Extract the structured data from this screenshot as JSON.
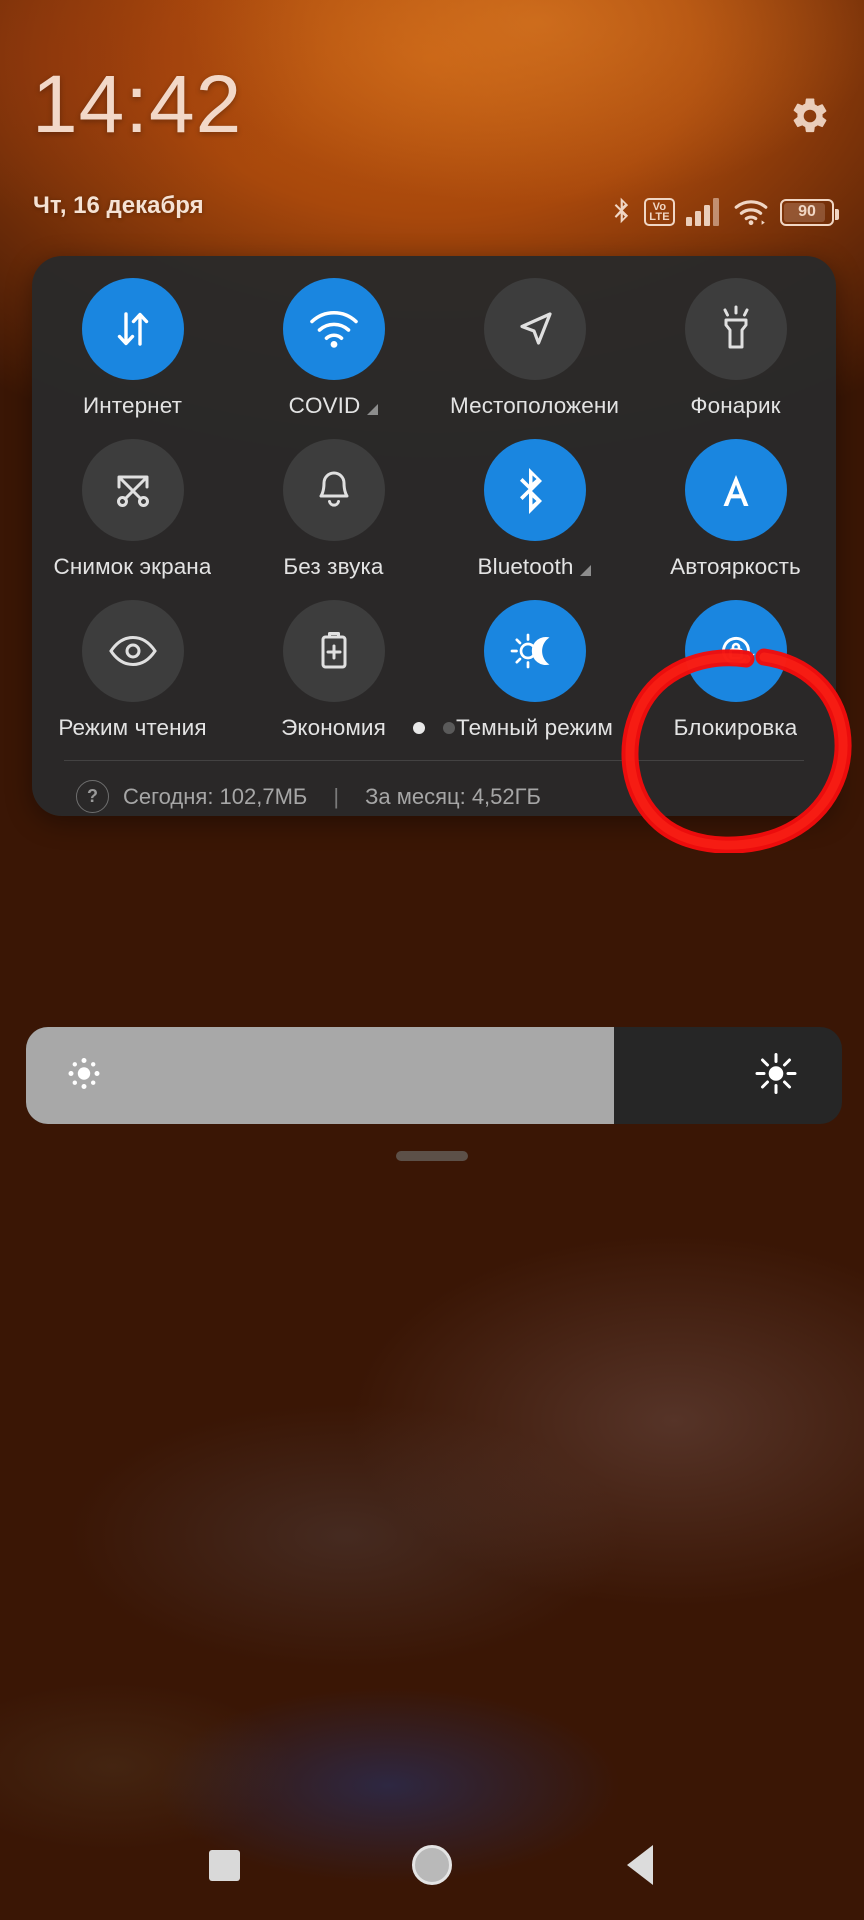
{
  "statusbar": {
    "time": "14:42",
    "date": "Чт, 16 декабря",
    "settings_icon": "gear-icon",
    "icons": [
      {
        "name": "bluetooth-icon",
        "label": "Bluetooth"
      },
      {
        "name": "volte-icon",
        "label_top": "Vo",
        "label_bottom": "LTE"
      },
      {
        "name": "cellular-signal-icon",
        "label": "Signal"
      },
      {
        "name": "wifi-icon",
        "label": "Wi-Fi"
      },
      {
        "name": "battery-icon",
        "level": "90"
      }
    ],
    "battery_level": "90"
  },
  "quick_settings": {
    "tiles": [
      {
        "label": "Интернет",
        "icon": "data-transfer-icon",
        "active": true,
        "expandable": false,
        "clip": false
      },
      {
        "label": "COVID",
        "icon": "wifi-icon",
        "active": true,
        "expandable": true,
        "clip": false
      },
      {
        "label": "Местоположени",
        "icon": "location-arrow-icon",
        "active": false,
        "expandable": false,
        "clip": true
      },
      {
        "label": "Фонарик",
        "icon": "flashlight-icon",
        "active": false,
        "expandable": false,
        "clip": false
      },
      {
        "label": "Снимок экрана",
        "icon": "screenshot-icon",
        "active": false,
        "expandable": false,
        "clip": false
      },
      {
        "label": "Без звука",
        "icon": "bell-icon",
        "active": false,
        "expandable": false,
        "clip": false
      },
      {
        "label": "Bluetooth",
        "icon": "bluetooth-icon",
        "active": true,
        "expandable": true,
        "clip": false
      },
      {
        "label": "Автояркость",
        "icon": "auto-brightness-icon",
        "active": true,
        "expandable": false,
        "clip": false
      },
      {
        "label": "Режим чтения",
        "icon": "eye-icon",
        "active": false,
        "expandable": false,
        "clip": false
      },
      {
        "label": "Экономия",
        "icon": "battery-saver-icon",
        "active": false,
        "expandable": false,
        "clip": false
      },
      {
        "label": "Темный режим",
        "icon": "dark-mode-icon",
        "active": true,
        "expandable": false,
        "clip": false
      },
      {
        "label": "Блокировка",
        "icon": "rotation-lock-icon",
        "active": true,
        "expandable": false,
        "clip": false
      }
    ],
    "pages": {
      "count": 2,
      "current": 1
    },
    "data_usage": {
      "help_icon_label": "?",
      "today": "Сегодня: 102,7МБ",
      "separator": "|",
      "month": "За месяц: 4,52ГБ"
    }
  },
  "brightness": {
    "value_percent": 72,
    "low_icon": "brightness-low-icon",
    "high_icon": "brightness-high-icon"
  },
  "annotation": {
    "color": "#f20c0c",
    "target": "Блокировка",
    "shape": "hand-drawn-circle"
  },
  "navbar": {
    "buttons": [
      {
        "name": "recents-button",
        "glyph": "square"
      },
      {
        "name": "home-button",
        "glyph": "circle"
      },
      {
        "name": "back-button",
        "glyph": "triangle"
      }
    ]
  },
  "theme": {
    "accent": "#1a86e0",
    "panel_bg": "#292929",
    "tile_off_bg": "#3d3d3d",
    "text_primary": "#e3e3e3",
    "text_secondary": "#a6a6a6",
    "status_text": "#f0d6c4",
    "annotation_red": "#f20c0c"
  }
}
